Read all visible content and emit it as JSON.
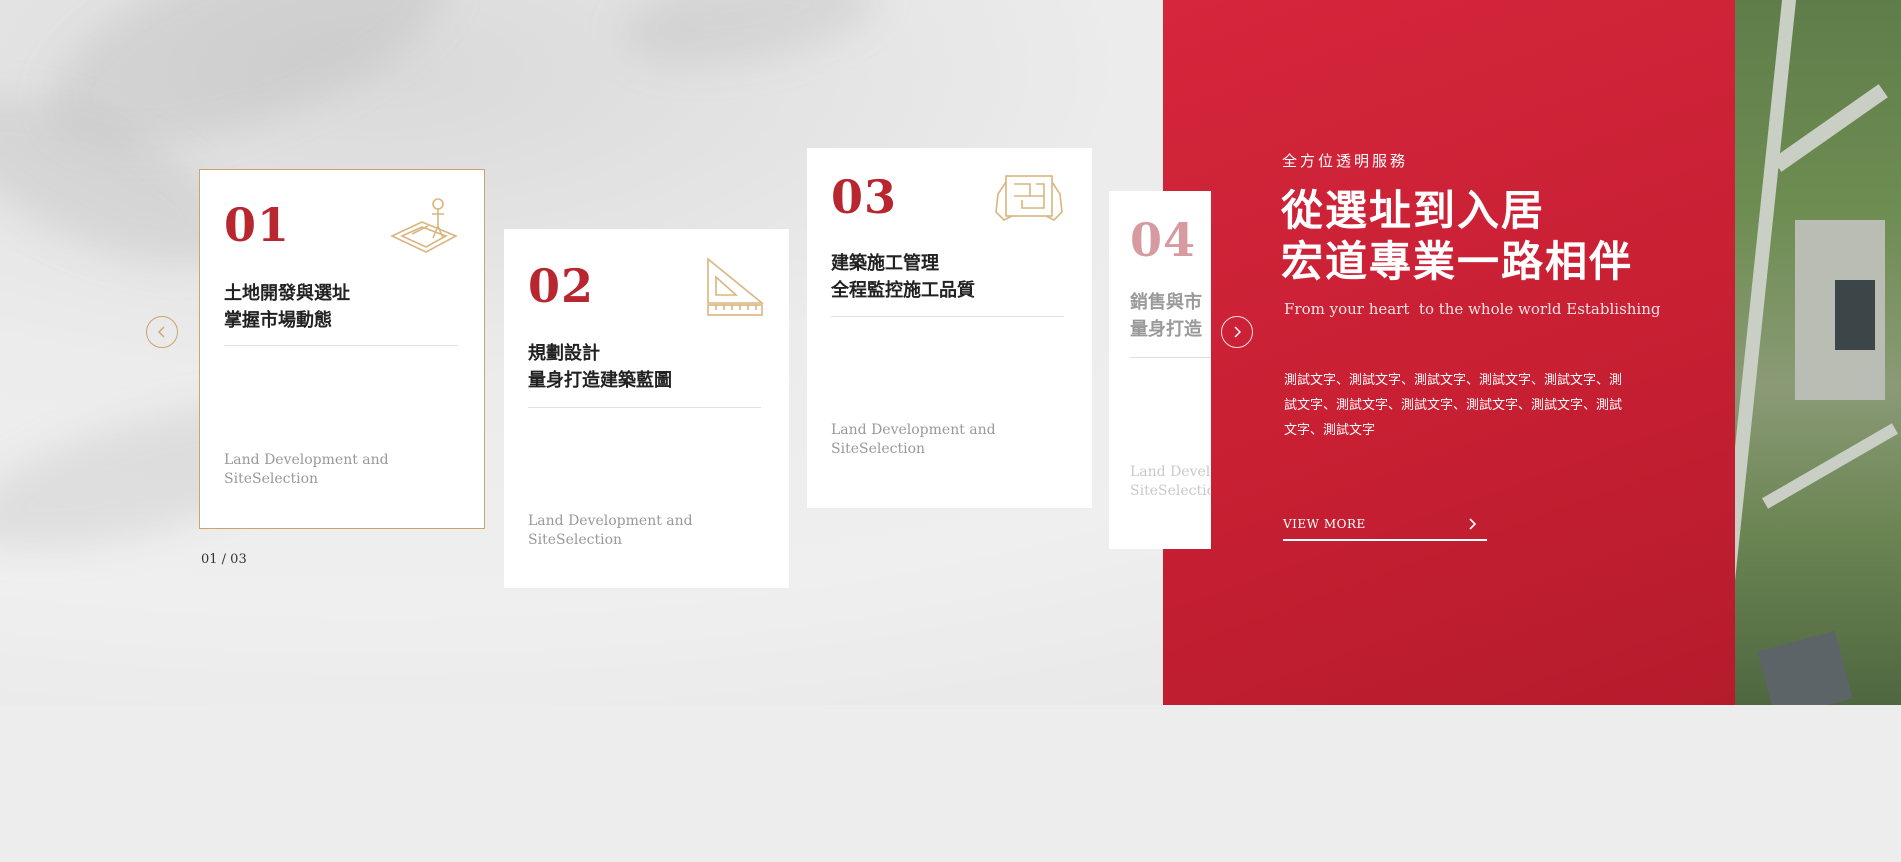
{
  "slider": {
    "pager": "01 / 03",
    "cards": [
      {
        "num": "01",
        "title": "土地開發與選址\n掌握市場動態",
        "sub": "Land Development and SiteSelection",
        "icon": "surveyor-icon"
      },
      {
        "num": "02",
        "title": "規劃設計\n量身打造建築藍圖",
        "sub": "Land Development and SiteSelection",
        "icon": "set-square-ruler-icon"
      },
      {
        "num": "03",
        "title": "建築施工管理\n全程監控施工品質",
        "sub": "Land Development and SiteSelection",
        "icon": "blueprint-hands-icon"
      },
      {
        "num": "04",
        "title": "銷售與市\n量身打造",
        "sub": "Land Devel\nSiteSelectic"
      }
    ]
  },
  "promo": {
    "eyebrow": "全方位透明服務",
    "headline": "從選址到入居\n宏道專業一路相伴",
    "tagline": "From your heart  to the whole world Establishing",
    "body": "測試文字、測試文字、測試文字、測試文字、測試文字、測試文字、測試文字、測試文字、測試文字、測試文字、測試文字、測試文字",
    "cta": "VIEW MORE"
  },
  "colors": {
    "accent": "#b8262f",
    "gold": "#c9a56b",
    "panel": "#cc2237"
  }
}
